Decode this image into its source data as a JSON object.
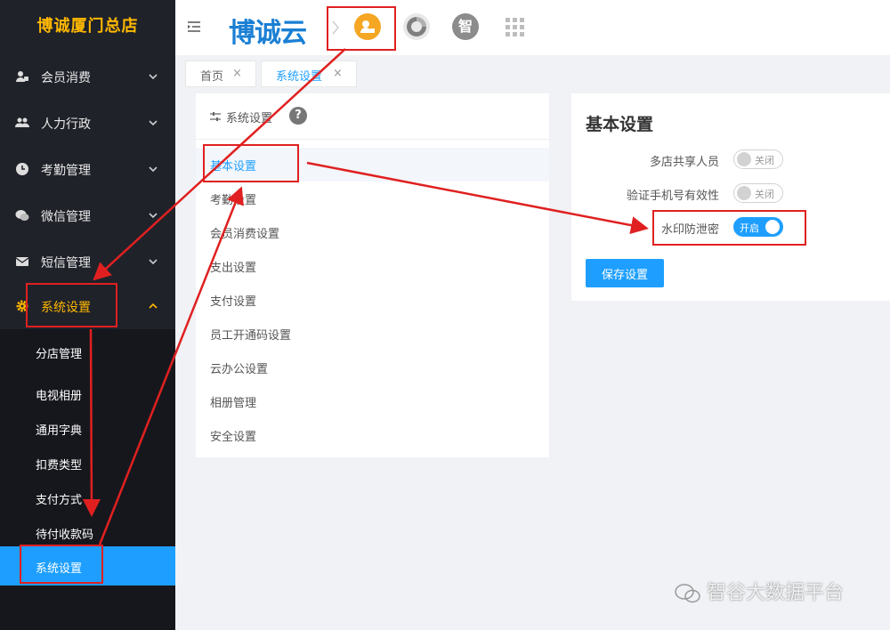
{
  "sidebar": {
    "brand": "博诚厦门总店",
    "menu": [
      {
        "label": "会员消费",
        "icon": "member-icon"
      },
      {
        "label": "人力行政",
        "icon": "users-icon"
      },
      {
        "label": "考勤管理",
        "icon": "clock-icon"
      },
      {
        "label": "微信管理",
        "icon": "wechat-icon"
      },
      {
        "label": "短信管理",
        "icon": "mail-icon"
      },
      {
        "label": "系统设置",
        "icon": "gear-icon"
      }
    ],
    "submenu": [
      "分店管理",
      "电视相册",
      "通用字典",
      "扣费类型",
      "支付方式",
      "待付收款码",
      "系统设置"
    ]
  },
  "header": {
    "logo": "博诚云",
    "apps": [
      {
        "icon": "user-card-icon",
        "color": "#f5a623"
      },
      {
        "icon": "swirl-icon",
        "color": "#7f7f7f"
      },
      {
        "icon": "zhi-icon",
        "label": "智",
        "color": "#8c8c8c"
      },
      {
        "icon": "grid-icon",
        "color": "#bdbdbd"
      }
    ]
  },
  "tabs": [
    {
      "label": "首页",
      "close": "×"
    },
    {
      "label": "系统设置",
      "close": "×"
    }
  ],
  "settings_list": {
    "title": "系统设置",
    "help": "?",
    "items": [
      "基本设置",
      "考勤设置",
      "会员消费设置",
      "支出设置",
      "支付设置",
      "员工开通码设置",
      "云办公设置",
      "相册管理",
      "安全设置"
    ]
  },
  "basic": {
    "title": "基本设置",
    "rows": [
      {
        "label": "多店共享人员",
        "state": "关闭",
        "on": false
      },
      {
        "label": "验证手机号有效性",
        "state": "关闭",
        "on": false
      },
      {
        "label": "水印防泄密",
        "state": "开启",
        "on": true
      }
    ],
    "save_label": "保存设置"
  },
  "watermark": "智谷大数据平台",
  "colors": {
    "sidebar_bg": "#20222a",
    "submenu_bg": "#16171d",
    "accent_yellow": "#ffb800",
    "accent_blue": "#1e9fff",
    "annotation_red": "#e02020"
  }
}
